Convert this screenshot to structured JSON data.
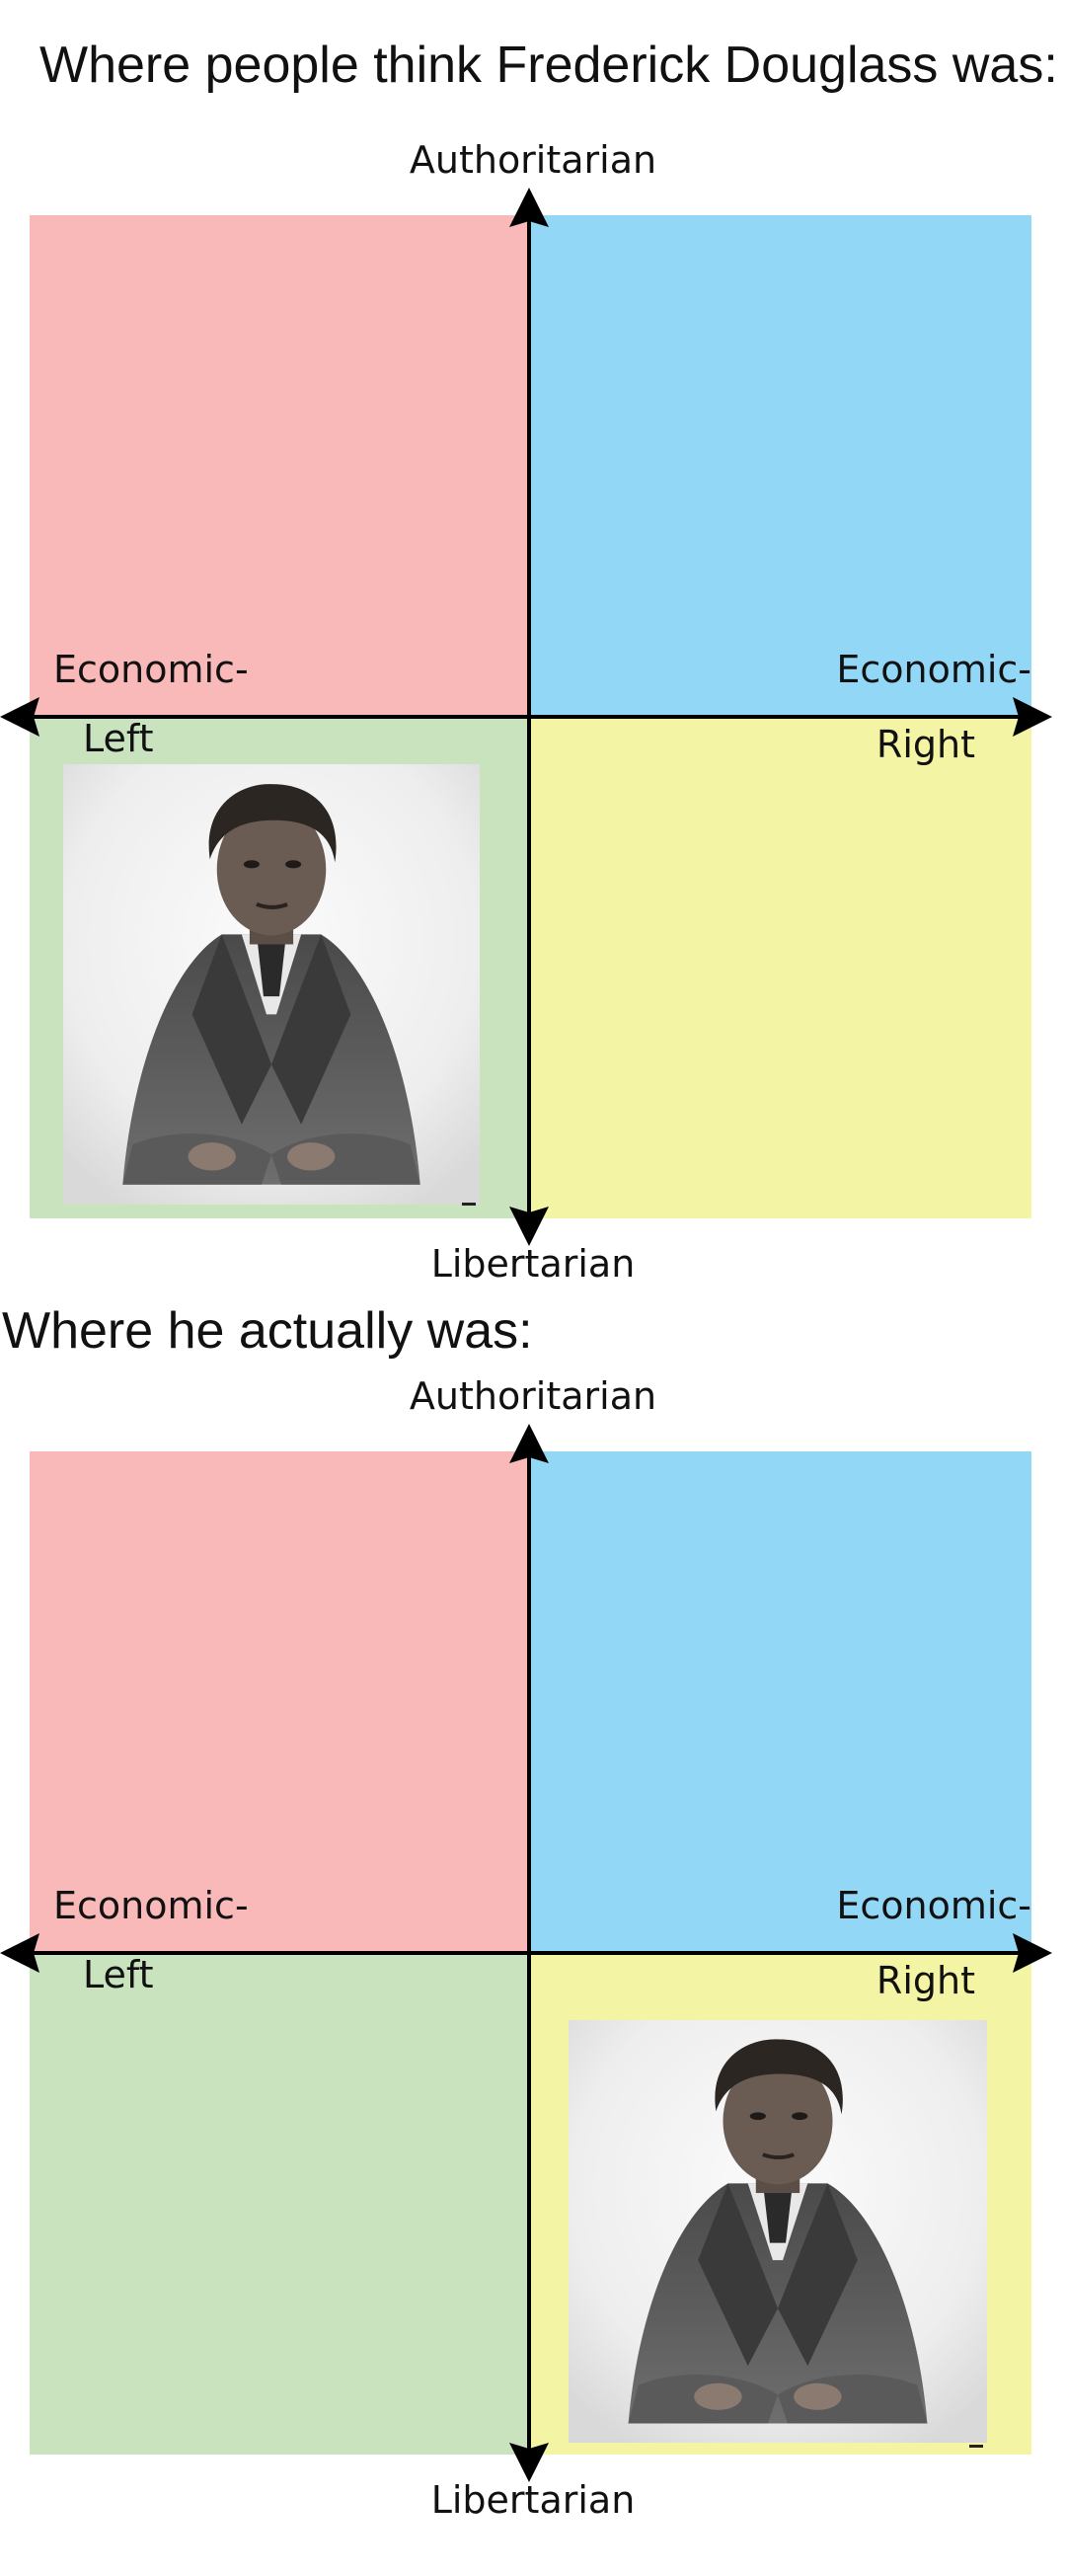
{
  "headings": {
    "top": "Where people think Frederick Douglass was:",
    "bottom": "Where he actually was:"
  },
  "axis_labels": {
    "top": "Authoritarian",
    "bottom": "Libertarian",
    "left_line1": "Economic-",
    "left_line2": "Left",
    "right_line1": "Economic-",
    "right_line2": "Right"
  },
  "colors": {
    "authoritarian_left": "#f9b9b9",
    "authoritarian_right": "#93d7f6",
    "libertarian_left": "#c9e3bf",
    "libertarian_right": "#f4f4a5",
    "axis": "#000000"
  },
  "compasses": [
    {
      "portrait_quadrant": "libertarian-left"
    },
    {
      "portrait_quadrant": "libertarian-right"
    }
  ],
  "icons": {
    "portrait": "frederick-douglass-portrait"
  }
}
